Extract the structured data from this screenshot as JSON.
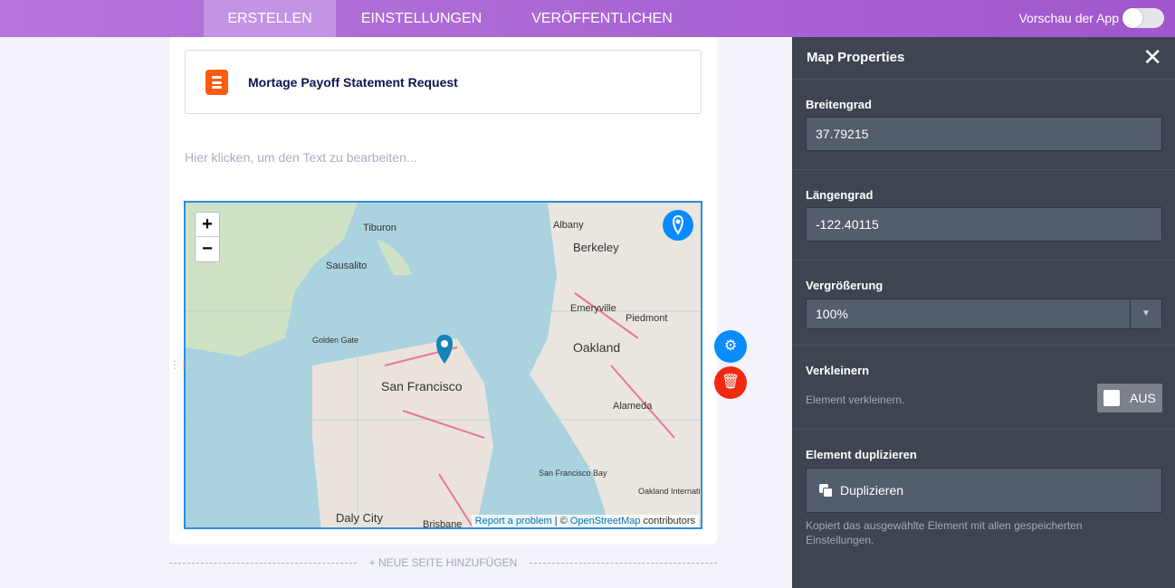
{
  "nav": {
    "tabs": [
      {
        "label": "ERSTELLEN",
        "active": true
      },
      {
        "label": "EINSTELLUNGEN"
      },
      {
        "label": "VERÖFFENTLICHEN"
      }
    ],
    "preview_label": "Vorschau der App",
    "preview_on": false
  },
  "form": {
    "title": "Mortage Payoff Statement Request",
    "text_placeholder": "Hier klicken, um den Text zu bearbeiten...",
    "add_page": "+ NEUE SEITE HINZUFÜGEN"
  },
  "map": {
    "zoom_in": "+",
    "zoom_out": "−",
    "labels": [
      "Tiburon",
      "Albany",
      "Berkeley",
      "Sausalito",
      "Emeryville",
      "Piedmont",
      "Oakland",
      "Golden Gate",
      "San Francisco",
      "Alameda",
      "San Francisco Bay",
      "Oakland International Airport",
      "Daly City",
      "Brisbane"
    ],
    "attribution": {
      "report": "Report a problem",
      "sep": " | © ",
      "osm": "OpenStreetMap",
      "contrib": " contributors"
    }
  },
  "panel": {
    "title": "Map Properties",
    "latitude": {
      "label": "Breitengrad",
      "value": "37.79215"
    },
    "longitude": {
      "label": "Längengrad",
      "value": "-122.40115"
    },
    "zoom": {
      "label": "Vergrößerung",
      "value": "100%"
    },
    "shrink": {
      "label": "Verkleinern",
      "hint": "Element verkleinern.",
      "state": "AUS"
    },
    "duplicate": {
      "label": "Element duplizieren",
      "button": "Duplizieren",
      "hint": "Kopiert das ausgewählte Element mit allen gespeicherten Einstellungen."
    }
  },
  "colors": {
    "accent": "#a057cd",
    "panel": "#3e4450",
    "settings": "#0a8cff",
    "delete": "#f02a10"
  }
}
